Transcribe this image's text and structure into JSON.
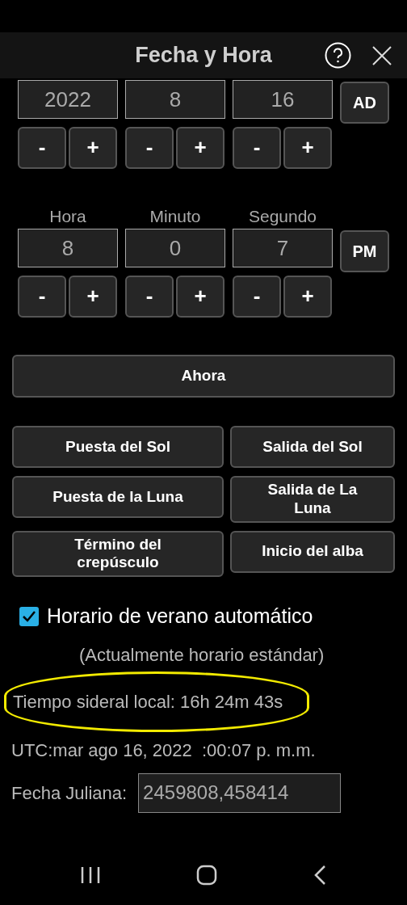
{
  "header": {
    "title": "Fecha y Hora"
  },
  "date": {
    "fields": [
      {
        "value": "2022",
        "decrement": "-",
        "increment": "+"
      },
      {
        "value": "8",
        "decrement": "-",
        "increment": "+"
      },
      {
        "value": "16",
        "decrement": "-",
        "increment": "+"
      }
    ],
    "era_button": "AD"
  },
  "time": {
    "fields": [
      {
        "label": "Hora",
        "value": "8",
        "decrement": "-",
        "increment": "+"
      },
      {
        "label": "Minuto",
        "value": "0",
        "decrement": "-",
        "increment": "+"
      },
      {
        "label": "Segundo",
        "value": "7",
        "decrement": "-",
        "increment": "+"
      }
    ],
    "ampm_button": "PM"
  },
  "now_button": "Ahora",
  "events": [
    {
      "label": "Puesta del Sol"
    },
    {
      "label": "Salida del Sol"
    },
    {
      "label": "Puesta de la Luna"
    },
    {
      "label": "Salida de La Luna"
    },
    {
      "label": "Término del crepúsculo"
    },
    {
      "label": "Inicio del alba"
    }
  ],
  "dst": {
    "label": "Horario de verano automático",
    "checked": true
  },
  "dst_note": "(Actualmente horario estándar)",
  "sidereal": {
    "text": "Tiempo sideral local: 16h 24m 43s",
    "highlighted": true
  },
  "utc": "UTC:mar ago 16, 2022  :00:07 p. m.m.",
  "julian": {
    "label": "Fecha Juliana:",
    "value": "2459808,458414"
  }
}
